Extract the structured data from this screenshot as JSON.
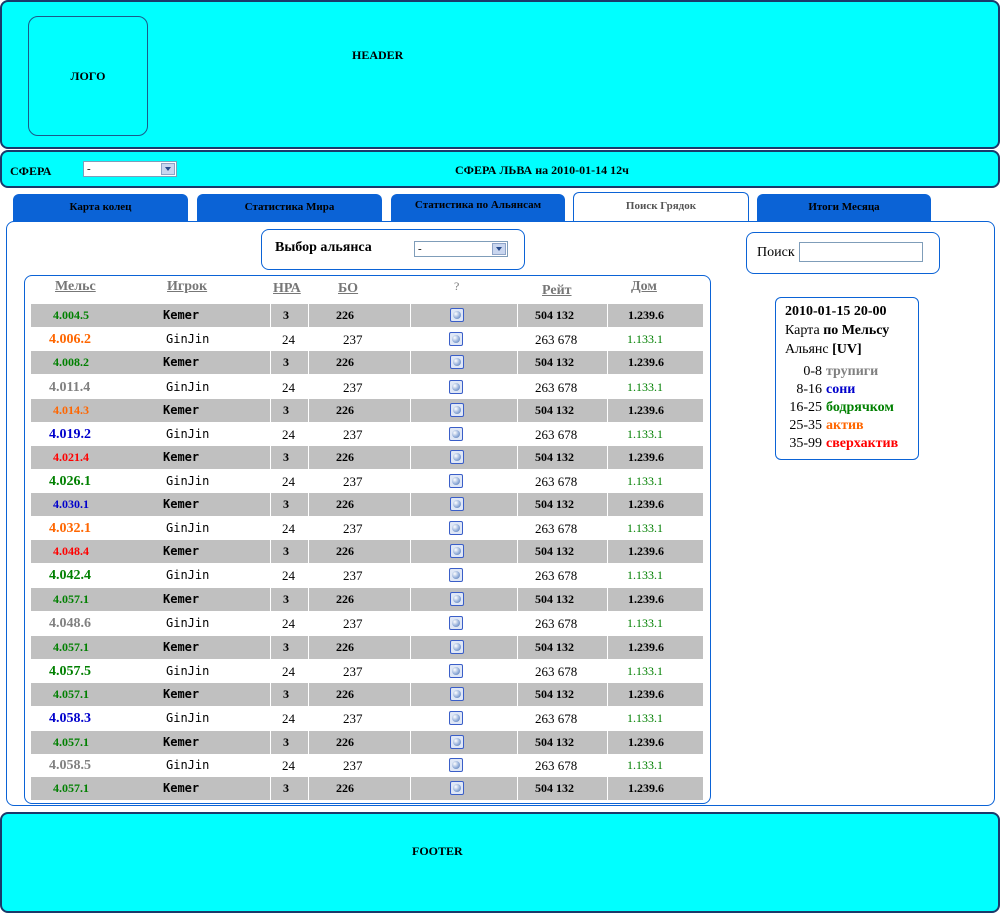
{
  "header": {
    "logo": "ЛОГО",
    "text": "HEADER"
  },
  "sphere_bar": {
    "label": "СФЕРА",
    "select_value": "-",
    "title": "СФЕРА ЛЬВА  на 2010-01-14 12ч"
  },
  "tabs": [
    "Карта колец",
    "Статистика Мира",
    "Статистика по Альянсам",
    "Поиск Грядок",
    "Итоги Месяца"
  ],
  "active_tab": 3,
  "alliance": {
    "label": "Выбор альянса",
    "select_value": "-"
  },
  "search": {
    "label": "Поиск",
    "value": ""
  },
  "table": {
    "headers": [
      "Мельс",
      "Игрок",
      "НРА",
      "БО",
      "?",
      "Рейт",
      "Дом"
    ],
    "rows": [
      {
        "mels": "4.004.5",
        "player": "Kemer",
        "hra": "3",
        "bo": "226",
        "rate": "504 132",
        "dom": "1.239.6"
      },
      {
        "mels": "4.006.2",
        "player": "GinJin",
        "hra": "24",
        "bo": "237",
        "rate": "263 678",
        "dom": "1.133.1"
      },
      {
        "mels": "4.008.2",
        "player": "Kemer",
        "hra": "3",
        "bo": "226",
        "rate": "504 132",
        "dom": "1.239.6"
      },
      {
        "mels": "4.011.4",
        "player": "GinJin",
        "hra": "24",
        "bo": "237",
        "rate": "263 678",
        "dom": "1.133.1"
      },
      {
        "mels": "4.014.3",
        "player": "Kemer",
        "hra": "3",
        "bo": "226",
        "rate": "504 132",
        "dom": "1.239.6"
      },
      {
        "mels": "4.019.2",
        "player": "GinJin",
        "hra": "24",
        "bo": "237",
        "rate": "263 678",
        "dom": "1.133.1"
      },
      {
        "mels": "4.021.4",
        "player": "Kemer",
        "hra": "3",
        "bo": "226",
        "rate": "504 132",
        "dom": "1.239.6"
      },
      {
        "mels": "4.026.1",
        "player": "GinJin",
        "hra": "24",
        "bo": "237",
        "rate": "263 678",
        "dom": "1.133.1"
      },
      {
        "mels": "4.030.1",
        "player": "Kemer",
        "hra": "3",
        "bo": "226",
        "rate": "504 132",
        "dom": "1.239.6"
      },
      {
        "mels": "4.032.1",
        "player": "GinJin",
        "hra": "24",
        "bo": "237",
        "rate": "263 678",
        "dom": "1.133.1"
      },
      {
        "mels": "4.048.4",
        "player": "Kemer",
        "hra": "3",
        "bo": "226",
        "rate": "504 132",
        "dom": "1.239.6"
      },
      {
        "mels": "4.042.4",
        "player": "GinJin",
        "hra": "24",
        "bo": "237",
        "rate": "263 678",
        "dom": "1.133.1"
      },
      {
        "mels": "4.057.1",
        "player": "Kemer",
        "hra": "3",
        "bo": "226",
        "rate": "504 132",
        "dom": "1.239.6"
      },
      {
        "mels": "4.048.6",
        "player": "GinJin",
        "hra": "24",
        "bo": "237",
        "rate": "263 678",
        "dom": "1.133.1"
      },
      {
        "mels": "4.057.1",
        "player": "Kemer",
        "hra": "3",
        "bo": "226",
        "rate": "504 132",
        "dom": "1.239.6"
      },
      {
        "mels": "4.057.5",
        "player": "GinJin",
        "hra": "24",
        "bo": "237",
        "rate": "263 678",
        "dom": "1.133.1"
      },
      {
        "mels": "4.057.1",
        "player": "Kemer",
        "hra": "3",
        "bo": "226",
        "rate": "504 132",
        "dom": "1.239.6"
      },
      {
        "mels": "4.058.3",
        "player": "GinJin",
        "hra": "24",
        "bo": "237",
        "rate": "263 678",
        "dom": "1.133.1"
      },
      {
        "mels": "4.057.1",
        "player": "Kemer",
        "hra": "3",
        "bo": "226",
        "rate": "504 132",
        "dom": "1.239.6"
      },
      {
        "mels": "4.058.5",
        "player": "GinJin",
        "hra": "24",
        "bo": "237",
        "rate": "263 678",
        "dom": "1.133.1"
      },
      {
        "mels": "4.057.1",
        "player": "Kemer",
        "hra": "3",
        "bo": "226",
        "rate": "504 132",
        "dom": "1.239.6"
      }
    ],
    "mels_colors": [
      "#008000",
      "#ff6600",
      "#008000",
      "#808080",
      "#ff6600",
      "#0000cc",
      "#ff0000",
      "#008000",
      "#0000cc",
      "#ff6600",
      "#ff0000",
      "#008000",
      "#008000",
      "#808080",
      "#008000",
      "#008000",
      "#008000",
      "#0000cc",
      "#008000",
      "#808080",
      "#008000"
    ],
    "dom_color_light": "#008000"
  },
  "legend": {
    "date": "2010-01-15 20-00",
    "map_prefix": "Карта ",
    "map_value": "по Мельсу",
    "alliance_prefix": "Альянс ",
    "alliance_value": "[UV]",
    "items": [
      {
        "range": "0-8",
        "label": "трупиги",
        "color": "#808080"
      },
      {
        "range": "8-16",
        "label": "сони",
        "color": "#0000cc"
      },
      {
        "range": "16-25",
        "label": "бодрячком",
        "color": "#008000"
      },
      {
        "range": "25-35",
        "label": "актив",
        "color": "#ff6600"
      },
      {
        "range": "35-99",
        "label": "сверхактив",
        "color": "#ff0000"
      }
    ]
  },
  "footer": {
    "text": "FOOTER"
  }
}
